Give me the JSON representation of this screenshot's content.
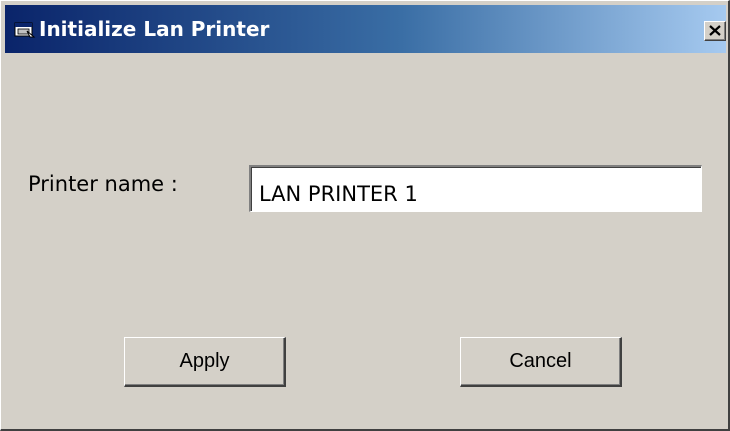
{
  "window": {
    "title": "Initialize Lan Printer",
    "title_icon": "printer-window-icon",
    "close_icon": "close-icon",
    "colors": {
      "titlebar_start": "#0a246a",
      "titlebar_end": "#a6caf0",
      "face": "#d4d0c8"
    }
  },
  "form": {
    "printer_name_label": "Printer name :",
    "printer_name_value": "LAN PRINTER 1"
  },
  "buttons": {
    "apply_label": "Apply",
    "cancel_label": "Cancel"
  }
}
